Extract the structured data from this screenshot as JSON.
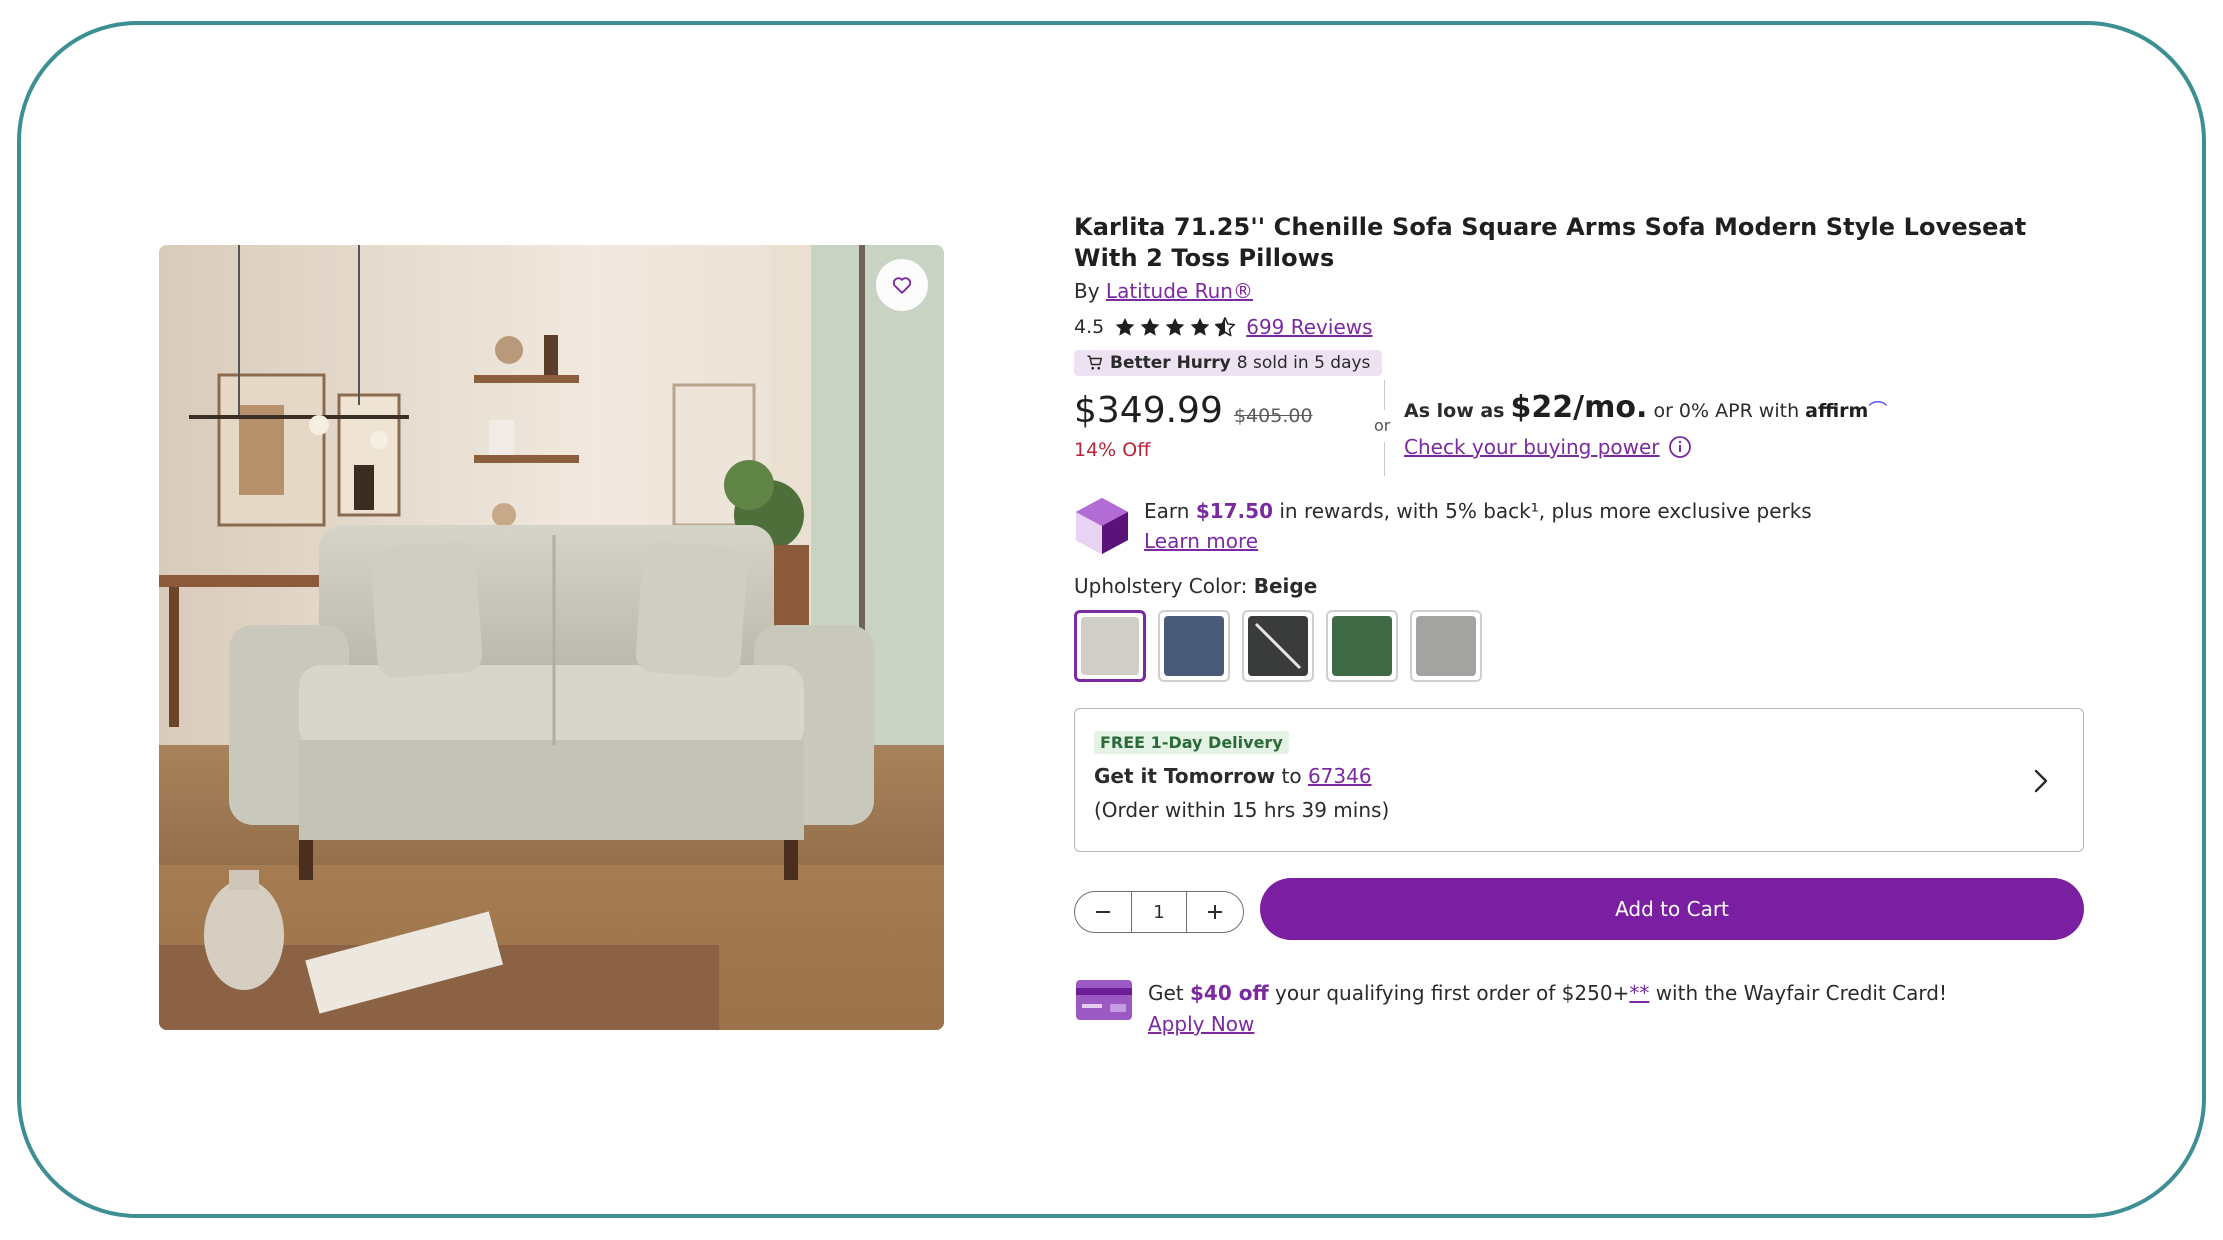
{
  "product": {
    "title": "Karlita 71.25'' Chenille Sofa Square Arms Sofa Modern Style Loveseat With 2 Toss Pillows",
    "by_label": "By",
    "brand": "Latitude Run®",
    "rating": "4.5",
    "stars_value": 4.5,
    "reviews_label": "699 Reviews",
    "hurry_bold": "Better Hurry",
    "hurry_text": "8 sold in 5 days"
  },
  "price": {
    "current": "$349.99",
    "original": "$405.00",
    "discount": "14% Off",
    "or_label": "or",
    "affirm_prefix": "As low as",
    "affirm_amount": "$22/mo.",
    "affirm_suffix": "or 0% APR with",
    "affirm_logo": "affirm",
    "buying_power_link": "Check your buying power"
  },
  "rewards": {
    "earn": "Earn",
    "amount": "$17.50",
    "text": "in rewards, with 5% back¹, plus more exclusive perks",
    "learn_more": "Learn more"
  },
  "color": {
    "label": "Upholstery Color:",
    "selected": "Beige",
    "swatches": [
      {
        "name": "Beige",
        "color": "#cfcec7"
      },
      {
        "name": "Blue",
        "color": "#4a5b77"
      },
      {
        "name": "Black",
        "color": "#3a3c3b"
      },
      {
        "name": "Green",
        "color": "#3f6a45"
      },
      {
        "name": "Gray",
        "color": "#a3a3a2"
      }
    ]
  },
  "delivery": {
    "badge": "FREE 1-Day Delivery",
    "get_it": "Get it Tomorrow",
    "to": "to",
    "zip": "67346",
    "order_within": "(Order within 15 hrs 39 mins)"
  },
  "cart": {
    "quantity": "1",
    "add_to_cart": "Add to Cart"
  },
  "credit": {
    "get": "Get",
    "amount": "$40 off",
    "text1": "your qualifying first order of $250+",
    "footnote": "**",
    "text2": "with the Wayfair Credit Card!",
    "apply": "Apply Now"
  },
  "colors": {
    "accent": "#7b1fa2",
    "link": "#7b2aa0",
    "discount": "#b4263a",
    "frame": "#3d8f94"
  }
}
